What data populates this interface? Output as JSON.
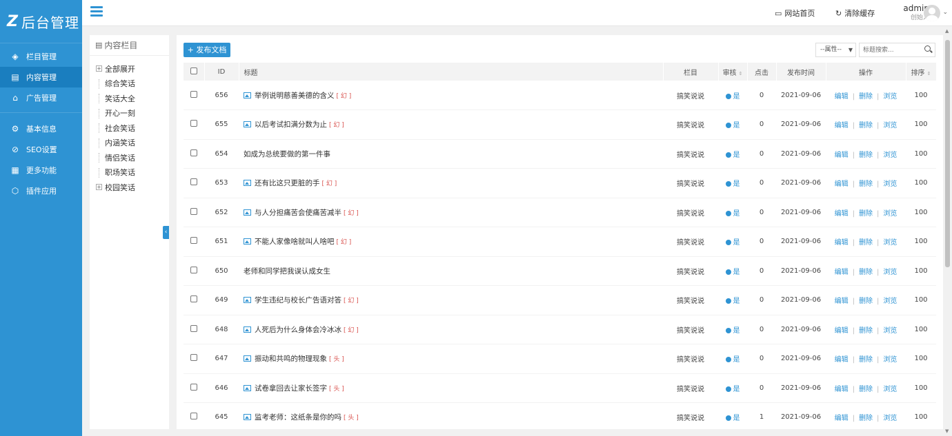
{
  "brand": {
    "mark": "Z",
    "title": "后台管理"
  },
  "sidebar": {
    "items": [
      {
        "label": "栏目管理",
        "icon": "layers-icon"
      },
      {
        "label": "内容管理",
        "icon": "document-icon"
      },
      {
        "label": "广告管理",
        "icon": "ad-icon"
      },
      {
        "label": "基本信息",
        "icon": "gear-icon"
      },
      {
        "label": "SEO设置",
        "icon": "compass-icon"
      },
      {
        "label": "更多功能",
        "icon": "grid-icon"
      },
      {
        "label": "插件应用",
        "icon": "cube-icon"
      }
    ]
  },
  "topbar": {
    "home_label": "网站首页",
    "cache_label": "清除缓存",
    "user_name": "admin",
    "user_role": "创始人"
  },
  "tree": {
    "heading": "内容栏目",
    "items": [
      {
        "label": "全部展开",
        "toggle": "+"
      },
      {
        "label": "综合笑话"
      },
      {
        "label": "笑话大全"
      },
      {
        "label": "开心一刻"
      },
      {
        "label": "社会笑话"
      },
      {
        "label": "内涵笑话"
      },
      {
        "label": "情侣笑话"
      },
      {
        "label": "职场笑话"
      },
      {
        "label": "校园笑话",
        "toggle": "+"
      }
    ]
  },
  "toolbar": {
    "publish_label": "+ 发布文档",
    "attr_select": "--属性--",
    "search_placeholder": "标题搜索..."
  },
  "table": {
    "headers": {
      "id": "ID",
      "title": "标题",
      "column": "栏目",
      "audit": "审核",
      "clicks": "点击",
      "date": "发布时间",
      "ops": "操作",
      "order": "排序"
    },
    "op_labels": {
      "edit": "编辑",
      "delete": "删除",
      "view": "浏览"
    },
    "rows": [
      {
        "id": "656",
        "title": "举例说明慈善美德的含义",
        "flag": "[ 幻 ]",
        "pic": true,
        "column": "搞笑说说",
        "audit": "是",
        "clicks": "0",
        "date": "2021-09-06",
        "order": "100"
      },
      {
        "id": "655",
        "title": "以后考试扣满分数为止",
        "flag": "[ 幻 ]",
        "pic": true,
        "column": "搞笑说说",
        "audit": "是",
        "clicks": "0",
        "date": "2021-09-06",
        "order": "100"
      },
      {
        "id": "654",
        "title": "如成为总统要做的第一件事",
        "flag": "",
        "pic": false,
        "column": "搞笑说说",
        "audit": "是",
        "clicks": "0",
        "date": "2021-09-06",
        "order": "100"
      },
      {
        "id": "653",
        "title": "还有比这只更脏的手",
        "flag": "[ 幻 ]",
        "pic": true,
        "column": "搞笑说说",
        "audit": "是",
        "clicks": "0",
        "date": "2021-09-06",
        "order": "100"
      },
      {
        "id": "652",
        "title": "与人分担痛苦会使痛苦减半",
        "flag": "[ 幻 ]",
        "pic": true,
        "column": "搞笑说说",
        "audit": "是",
        "clicks": "0",
        "date": "2021-09-06",
        "order": "100"
      },
      {
        "id": "651",
        "title": "不能人家像啥就叫人啥吧",
        "flag": "[ 幻 ]",
        "pic": true,
        "column": "搞笑说说",
        "audit": "是",
        "clicks": "0",
        "date": "2021-09-06",
        "order": "100"
      },
      {
        "id": "650",
        "title": "老师和同学把我误认成女生",
        "flag": "",
        "pic": false,
        "column": "搞笑说说",
        "audit": "是",
        "clicks": "0",
        "date": "2021-09-06",
        "order": "100"
      },
      {
        "id": "649",
        "title": "学生违纪与校长广告语对答",
        "flag": "[ 幻 ]",
        "pic": true,
        "column": "搞笑说说",
        "audit": "是",
        "clicks": "0",
        "date": "2021-09-06",
        "order": "100"
      },
      {
        "id": "648",
        "title": "人死后为什么身体会冷冰冰",
        "flag": "[ 幻 ]",
        "pic": true,
        "column": "搞笑说说",
        "audit": "是",
        "clicks": "0",
        "date": "2021-09-06",
        "order": "100"
      },
      {
        "id": "647",
        "title": "振动和共鸣的物理现象",
        "flag": "[ 头 ]",
        "pic": true,
        "column": "搞笑说说",
        "audit": "是",
        "clicks": "0",
        "date": "2021-09-06",
        "order": "100"
      },
      {
        "id": "646",
        "title": "试卷拿回去让家长签字",
        "flag": "[ 头 ]",
        "pic": true,
        "column": "搞笑说说",
        "audit": "是",
        "clicks": "0",
        "date": "2021-09-06",
        "order": "100"
      },
      {
        "id": "645",
        "title": "监考老师：这纸条是你的吗",
        "flag": "[ 头 ]",
        "pic": true,
        "column": "搞笑说说",
        "audit": "是",
        "clicks": "1",
        "date": "2021-09-06",
        "order": "100"
      }
    ]
  },
  "colors": {
    "primary": "#2e93d3",
    "flag": "#d9534f"
  }
}
